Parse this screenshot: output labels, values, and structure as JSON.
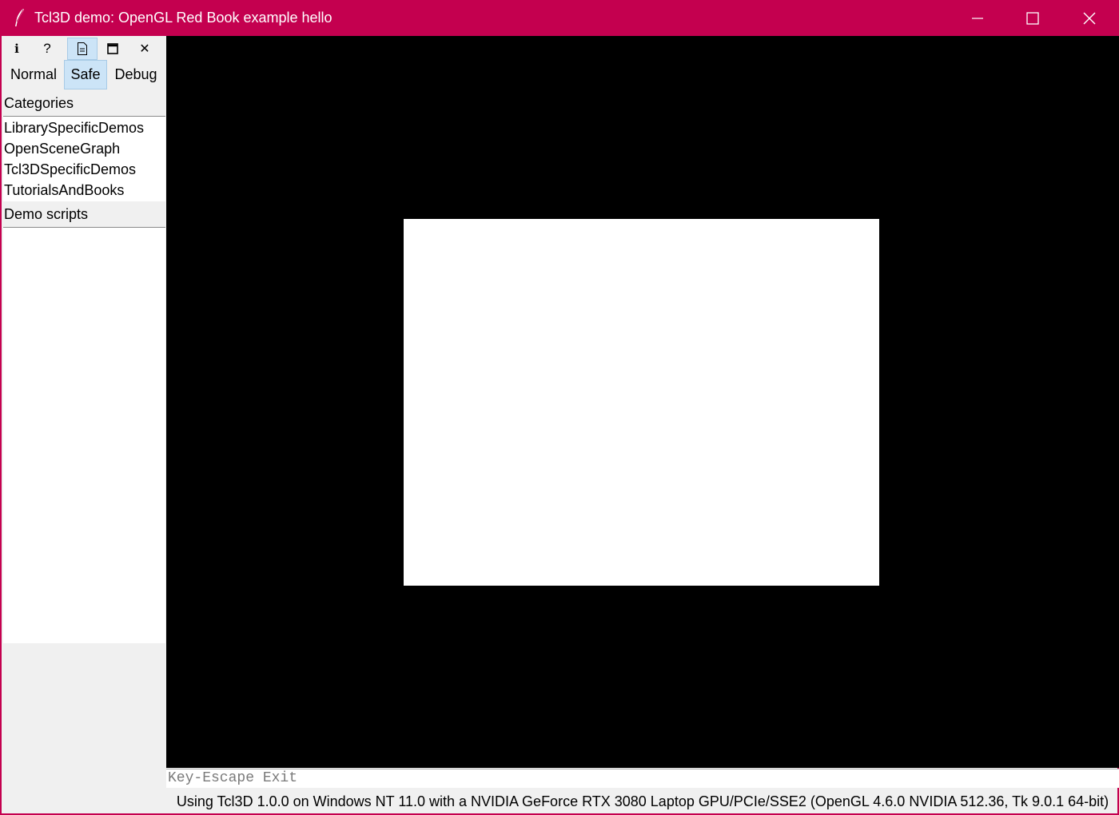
{
  "window": {
    "title": "Tcl3D demo: OpenGL Red Book example hello",
    "accent_color": "#c4004f",
    "app_icon": "feather-icon",
    "controls": [
      "minimize-icon",
      "maximize-icon",
      "close-icon"
    ]
  },
  "toolbar": {
    "icons": [
      "info-icon",
      "help-icon",
      "document-icon",
      "window-icon",
      "close-icon"
    ],
    "info_glyph": "i",
    "help_glyph": "?",
    "close_glyph": "✕",
    "active_tool": "document-icon"
  },
  "modes": {
    "normal": "Normal",
    "safe": "Safe",
    "debug": "Debug",
    "selected": "Safe"
  },
  "categories": {
    "label": "Categories",
    "items": [
      "LibrarySpecificDemos",
      "OpenSceneGraph",
      "Tcl3DSpecificDemos",
      "TutorialsAndBooks"
    ]
  },
  "demo_scripts": {
    "label": "Demo scripts",
    "items": []
  },
  "canvas": {
    "background_color": "#000000",
    "shape_color": "#ffffff"
  },
  "key_info": "Key-Escape Exit",
  "status": "Using Tcl3D 1.0.0 on Windows NT 11.0 with a NVIDIA GeForce RTX 3080 Laptop GPU/PCIe/SSE2 (OpenGL 4.6.0 NVIDIA 512.36, Tk 9.0.1 64-bit)"
}
